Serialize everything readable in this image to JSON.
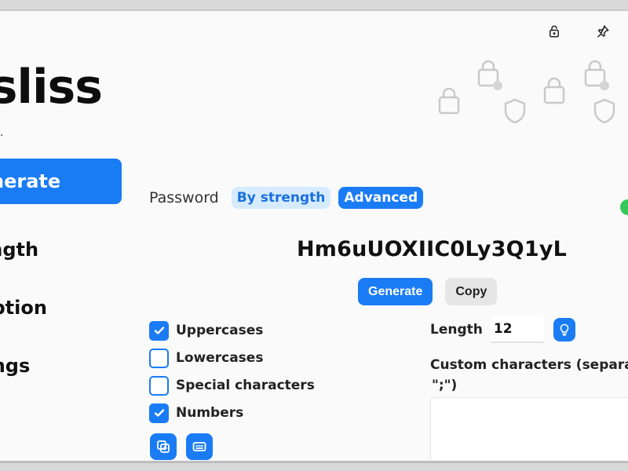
{
  "app": {
    "brand": "ssliss",
    "subtitle": "l."
  },
  "sidebar": {
    "items": [
      {
        "label": "nerate",
        "active": true
      },
      {
        "label": "ength"
      },
      {
        "label": "ryption"
      },
      {
        "label": "tings"
      }
    ]
  },
  "mode": {
    "label": "Password",
    "options": [
      "By strength",
      "Advanced"
    ],
    "selected": "Advanced"
  },
  "password": "Hm6uUOXIIC0Ly3Q1yL",
  "actions": {
    "generate": "Generate",
    "copy": "Copy"
  },
  "options": [
    {
      "label": "Uppercases",
      "checked": true
    },
    {
      "label": "Lowercases",
      "checked": false
    },
    {
      "label": "Special characters",
      "checked": false
    },
    {
      "label": "Numbers",
      "checked": true
    }
  ],
  "length": {
    "label": "Length",
    "value": "12"
  },
  "custom": {
    "label_line1": "Custom characters (separat",
    "label_line2": "\";\")",
    "value": ""
  },
  "icons": [
    "lock-icon",
    "pin-icon",
    "checkmark-icon",
    "copy-add-icon",
    "keyboard-icon",
    "lightbulb-icon"
  ],
  "colors": {
    "accent": "#1a7cf5",
    "accent_light": "#d6ebfd",
    "status": "#35c759"
  }
}
